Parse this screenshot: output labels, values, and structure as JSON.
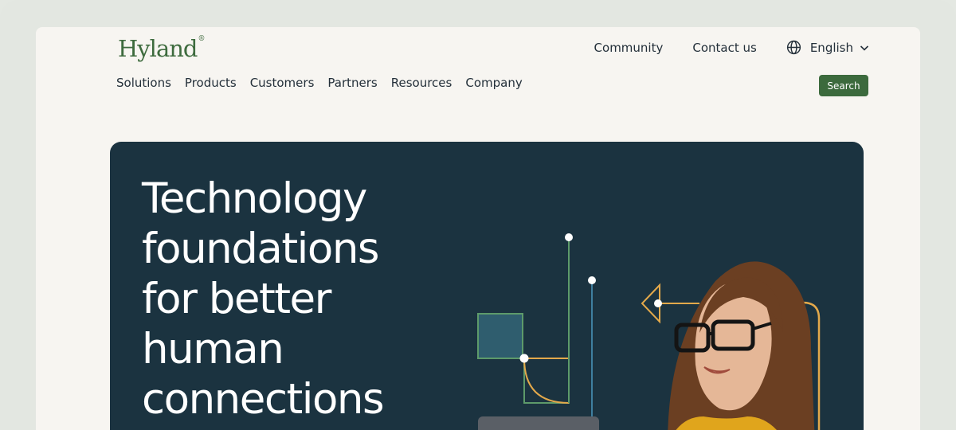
{
  "brand": {
    "name": "Hyland",
    "mark": "®",
    "color": "#3e6b3e"
  },
  "utility_nav": {
    "community": "Community",
    "contact": "Contact us",
    "language": "English",
    "icons": [
      "globe-icon",
      "chevron-down-icon"
    ]
  },
  "main_nav": {
    "items": [
      {
        "label": "Solutions"
      },
      {
        "label": "Products"
      },
      {
        "label": "Customers"
      },
      {
        "label": "Partners"
      },
      {
        "label": "Resources"
      },
      {
        "label": "Company"
      }
    ]
  },
  "search": {
    "label": "Search",
    "color": "#3c6a3d"
  },
  "hero": {
    "headline_lines": [
      "Technology",
      "foundations",
      "for better",
      "human",
      "connections"
    ],
    "background": "#1b3340",
    "accent_colors": {
      "green": "#5d9a6a",
      "gold": "#e3a94b",
      "blue": "#3f7fa0",
      "teal_block": "#2f5d6e"
    }
  }
}
